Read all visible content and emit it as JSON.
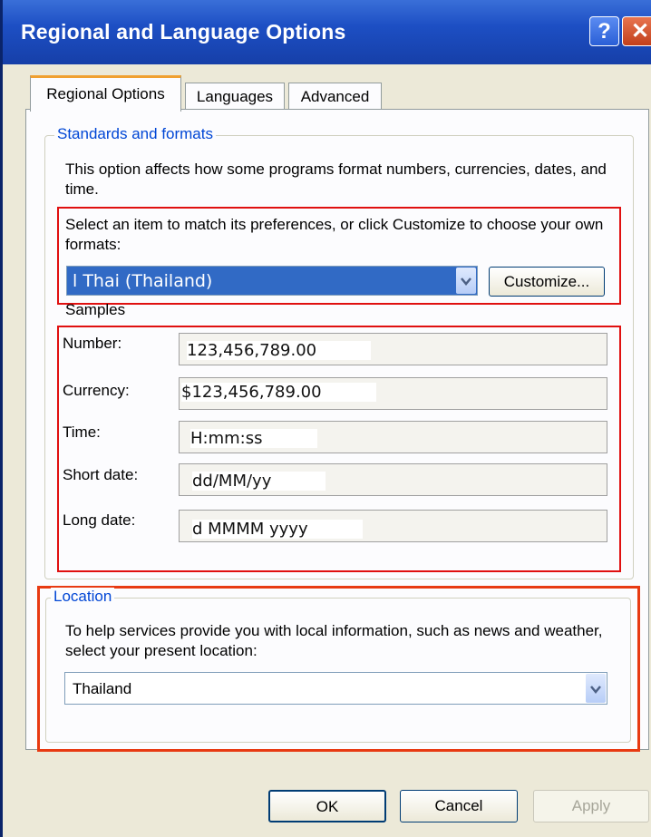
{
  "window": {
    "title": "Regional and Language Options",
    "help_label": "?",
    "close_label": "✕"
  },
  "tabs": [
    {
      "label": "Regional Options",
      "active": true
    },
    {
      "label": "Languages",
      "active": false
    },
    {
      "label": "Advanced",
      "active": false
    }
  ],
  "standards": {
    "legend": "Standards and formats",
    "description": "This option affects how some programs format numbers, currencies, dates, and time.",
    "select_prompt": "Select an item to match its preferences, or click Customize to choose your own formats:",
    "selected_format": "l Thai (Thailand)",
    "customize_label": "Customize..."
  },
  "samples": {
    "heading": "Samples",
    "rows": [
      {
        "label": "Number:",
        "value": "123,456,789.00"
      },
      {
        "label": "Currency:",
        "value": "$123,456,789.00"
      },
      {
        "label": "Time:",
        "value": "H:mm:ss"
      },
      {
        "label": "Short date:",
        "value": "dd/MM/yy"
      },
      {
        "label": "Long date:",
        "value": "d MMMM yyyy"
      }
    ]
  },
  "location": {
    "legend": "Location",
    "description": "To help services provide you with local information, such as news and weather, select your present location:",
    "selected": "Thailand"
  },
  "buttons": {
    "ok": "OK",
    "cancel": "Cancel",
    "apply": "Apply"
  },
  "colors": {
    "title_bar": "#1d4fc4",
    "highlight_box": "#e01010",
    "legend_text": "#0046d5",
    "selection": "#316ac5"
  },
  "icons": {
    "help": "question-mark-icon",
    "close": "close-icon",
    "dropdown": "chevron-down-icon"
  }
}
